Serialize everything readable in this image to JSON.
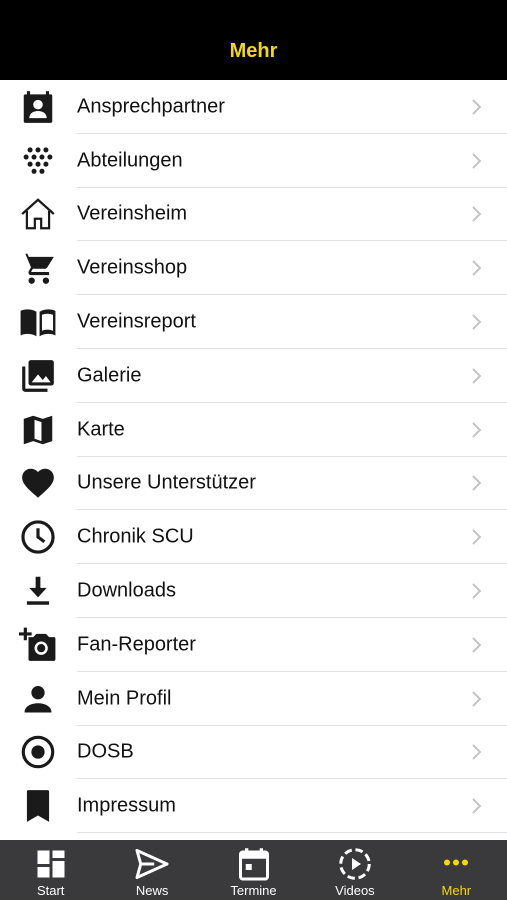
{
  "header": {
    "title": "Mehr"
  },
  "menu": {
    "items": [
      {
        "label": "Ansprechpartner",
        "icon": "contact-icon"
      },
      {
        "label": "Abteilungen",
        "icon": "dots-grid-icon"
      },
      {
        "label": "Vereinsheim",
        "icon": "home-icon"
      },
      {
        "label": "Vereinsshop",
        "icon": "cart-icon"
      },
      {
        "label": "Vereinsreport",
        "icon": "book-icon"
      },
      {
        "label": "Galerie",
        "icon": "gallery-icon"
      },
      {
        "label": "Karte",
        "icon": "map-icon"
      },
      {
        "label": "Unsere Unterstützer",
        "icon": "heart-icon"
      },
      {
        "label": "Chronik SCU",
        "icon": "clock-icon"
      },
      {
        "label": "Downloads",
        "icon": "download-icon"
      },
      {
        "label": "Fan-Reporter",
        "icon": "add-photo-icon"
      },
      {
        "label": "Mein Profil",
        "icon": "person-icon"
      },
      {
        "label": "DOSB",
        "icon": "radio-target-icon"
      },
      {
        "label": "Impressum",
        "icon": "bookmark-icon"
      }
    ]
  },
  "tabbar": {
    "tabs": [
      {
        "label": "Start",
        "icon": "dashboard-icon"
      },
      {
        "label": "News",
        "icon": "send-icon"
      },
      {
        "label": "Termine",
        "icon": "calendar-icon"
      },
      {
        "label": "Videos",
        "icon": "play-circle-icon"
      },
      {
        "label": "Mehr",
        "icon": "more-dots-icon"
      }
    ],
    "active_tab": "Mehr"
  },
  "colors": {
    "header_bg": "#000000",
    "accent": "#f5d90a",
    "tabbar_bg": "#3a3a3c",
    "icon": "#1a1a1a"
  }
}
